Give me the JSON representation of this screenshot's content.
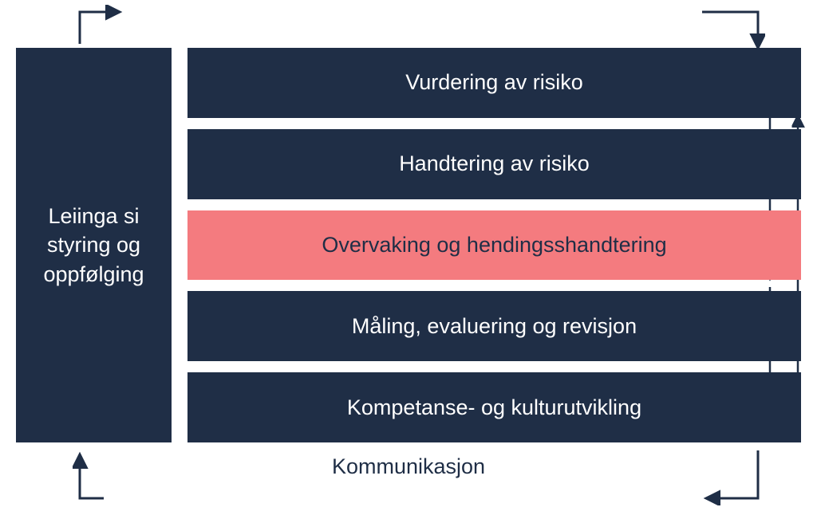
{
  "diagram": {
    "left_block": "Leiinga si styring og oppfølging",
    "steps": [
      {
        "label": "Vurdering av risiko",
        "highlight": false
      },
      {
        "label": "Handtering av risiko",
        "highlight": false
      },
      {
        "label": "Overvaking og hendingsshandtering",
        "highlight": true
      },
      {
        "label": "Måling, evaluering og revisjon",
        "highlight": false
      },
      {
        "label": "Kompetanse- og kulturutvikling",
        "highlight": false
      }
    ],
    "bottom_label": "Kommunikasjon"
  },
  "colors": {
    "box_bg": "#1f2e46",
    "box_text": "#ffffff",
    "highlight_bg": "#f47b7f",
    "highlight_text": "#1f2e46",
    "arrow": "#1f2e46"
  }
}
